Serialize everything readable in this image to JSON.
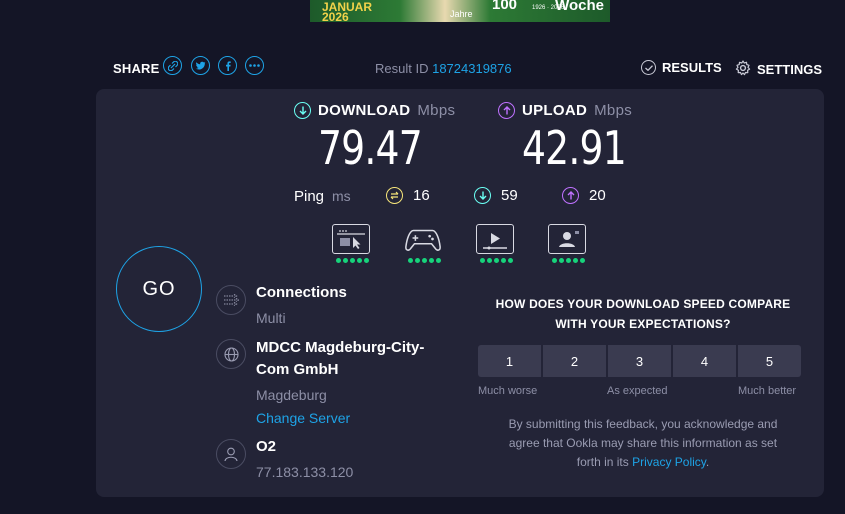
{
  "ad": {
    "line1": "JANUAR",
    "line2": "2026",
    "jahre": "Jahre",
    "num": "100",
    "years": "1926 · 2026",
    "woche": "Woche"
  },
  "share": {
    "label": "SHARE",
    "icons": [
      "link-icon",
      "twitter-icon",
      "facebook-icon",
      "more-icon"
    ]
  },
  "result": {
    "label": "Result ID",
    "id": "18724319876"
  },
  "nav": {
    "results": "RESULTS",
    "settings": "SETTINGS"
  },
  "download": {
    "label": "DOWNLOAD",
    "unit": "Mbps",
    "value": "79.47"
  },
  "upload": {
    "label": "UPLOAD",
    "unit": "Mbps",
    "value": "42.91"
  },
  "ping": {
    "label": "Ping",
    "unit": "ms",
    "idle": "16",
    "download": "59",
    "upload": "20"
  },
  "usecases": [
    {
      "icon": "web-browsing-icon",
      "rating": 5
    },
    {
      "icon": "gaming-icon",
      "rating": 5
    },
    {
      "icon": "video-streaming-icon",
      "rating": 5
    },
    {
      "icon": "video-chat-icon",
      "rating": 5
    }
  ],
  "go": "GO",
  "connections": {
    "title": "Connections",
    "value": "Multi"
  },
  "server": {
    "title_line1": "MDCC Magdeburg-City-",
    "title_line2": "Com GmbH",
    "location": "Magdeburg",
    "change": "Change Server"
  },
  "isp": {
    "name": "O2",
    "ip": "77.183.133.120"
  },
  "survey": {
    "question_line1": "HOW DOES YOUR DOWNLOAD SPEED COMPARE",
    "question_line2": "WITH YOUR EXPECTATIONS?",
    "options": [
      "1",
      "2",
      "3",
      "4",
      "5"
    ],
    "low": "Much worse",
    "mid": "As expected",
    "high": "Much better",
    "disclaimer_line1": "By submitting this feedback, you acknowledge and",
    "disclaimer_line2": "agree that Ookla may share this information as set",
    "disclaimer_line3": "forth in its",
    "policy_link": "Privacy Policy",
    "disclaimer_end": "."
  },
  "colors": {
    "background": "#141526",
    "panel": "#232437",
    "accent": "#1ea3e6",
    "download": "#6afff3",
    "upload": "#bf71ff",
    "idle": "#f6e57a",
    "good": "#17d37b"
  }
}
